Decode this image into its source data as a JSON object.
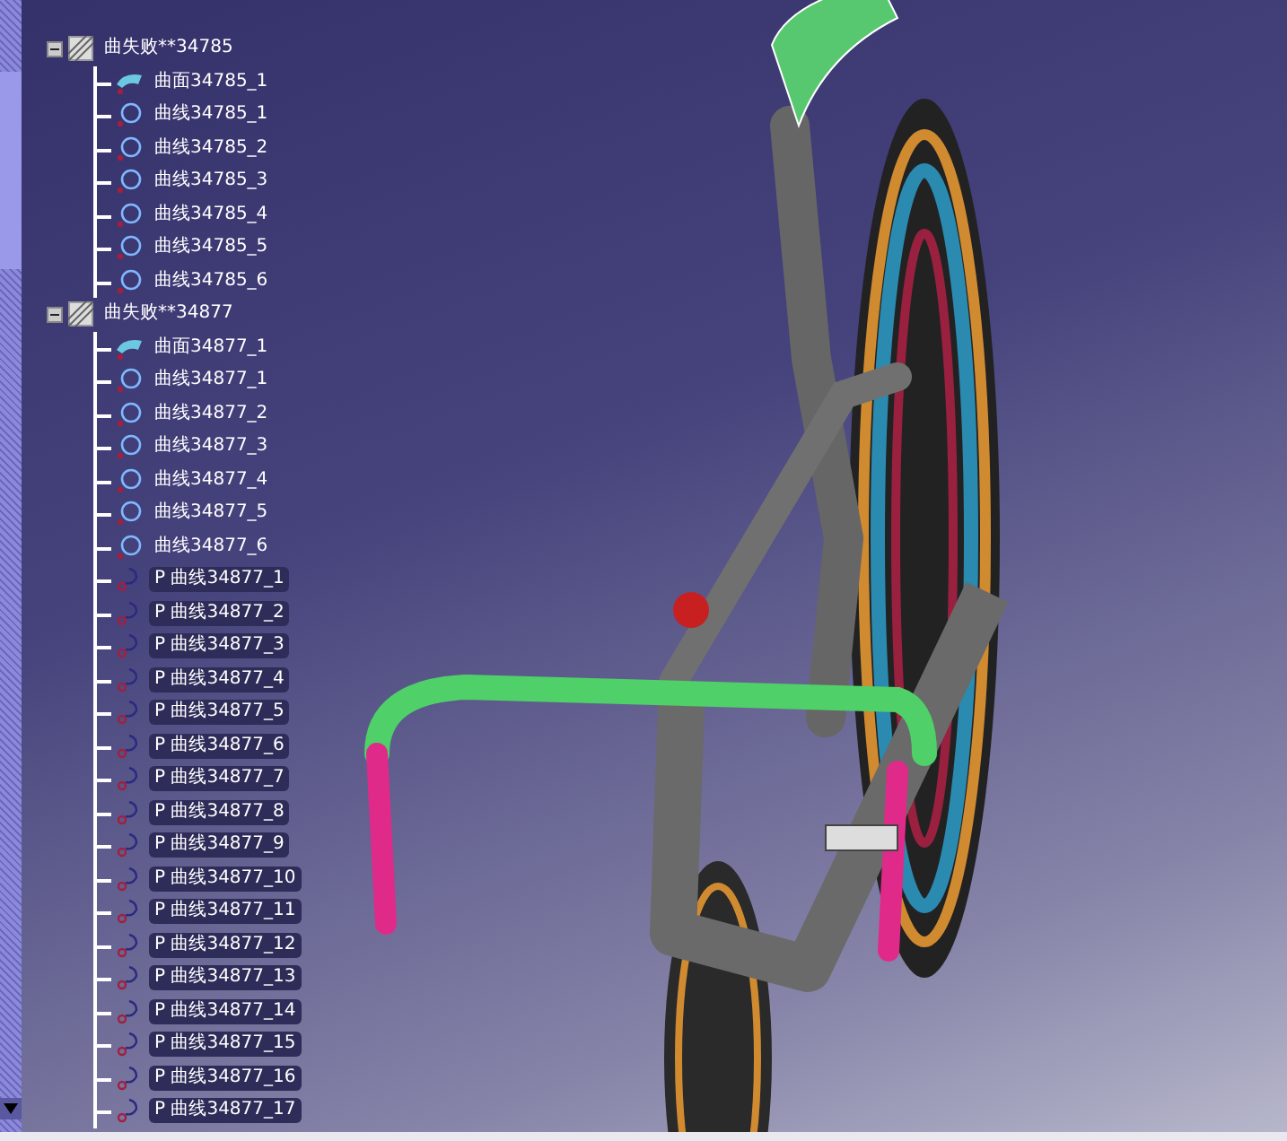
{
  "tree": [
    {
      "label": "曲失败**34785",
      "kind": "group",
      "expanded": true,
      "children": [
        {
          "label": "曲面34785_1",
          "kind": "surface"
        },
        {
          "label": "曲线34785_1",
          "kind": "curve"
        },
        {
          "label": "曲线34785_2",
          "kind": "curve"
        },
        {
          "label": "曲线34785_3",
          "kind": "curve"
        },
        {
          "label": "曲线34785_4",
          "kind": "curve"
        },
        {
          "label": "曲线34785_5",
          "kind": "curve"
        },
        {
          "label": "曲线34785_6",
          "kind": "curve"
        }
      ]
    },
    {
      "label": "曲失败**34877",
      "kind": "group",
      "expanded": true,
      "children": [
        {
          "label": "曲面34877_1",
          "kind": "surface"
        },
        {
          "label": "曲线34877_1",
          "kind": "curve"
        },
        {
          "label": "曲线34877_2",
          "kind": "curve"
        },
        {
          "label": "曲线34877_3",
          "kind": "curve"
        },
        {
          "label": "曲线34877_4",
          "kind": "curve"
        },
        {
          "label": "曲线34877_5",
          "kind": "curve"
        },
        {
          "label": "曲线34877_6",
          "kind": "curve"
        },
        {
          "label": "P 曲线34877_1",
          "kind": "pcurve"
        },
        {
          "label": "P 曲线34877_2",
          "kind": "pcurve"
        },
        {
          "label": "P 曲线34877_3",
          "kind": "pcurve"
        },
        {
          "label": "P 曲线34877_4",
          "kind": "pcurve"
        },
        {
          "label": "P 曲线34877_5",
          "kind": "pcurve"
        },
        {
          "label": "P 曲线34877_6",
          "kind": "pcurve"
        },
        {
          "label": "P 曲线34877_7",
          "kind": "pcurve"
        },
        {
          "label": "P 曲线34877_8",
          "kind": "pcurve"
        },
        {
          "label": "P 曲线34877_9",
          "kind": "pcurve"
        },
        {
          "label": "P 曲线34877_10",
          "kind": "pcurve"
        },
        {
          "label": "P 曲线34877_11",
          "kind": "pcurve"
        },
        {
          "label": "P 曲线34877_12",
          "kind": "pcurve"
        },
        {
          "label": "P 曲线34877_13",
          "kind": "pcurve"
        },
        {
          "label": "P 曲线34877_14",
          "kind": "pcurve"
        },
        {
          "label": "P 曲线34877_15",
          "kind": "pcurve"
        },
        {
          "label": "P 曲线34877_16",
          "kind": "pcurve"
        },
        {
          "label": "P 曲线34877_17",
          "kind": "pcurve"
        }
      ]
    }
  ]
}
